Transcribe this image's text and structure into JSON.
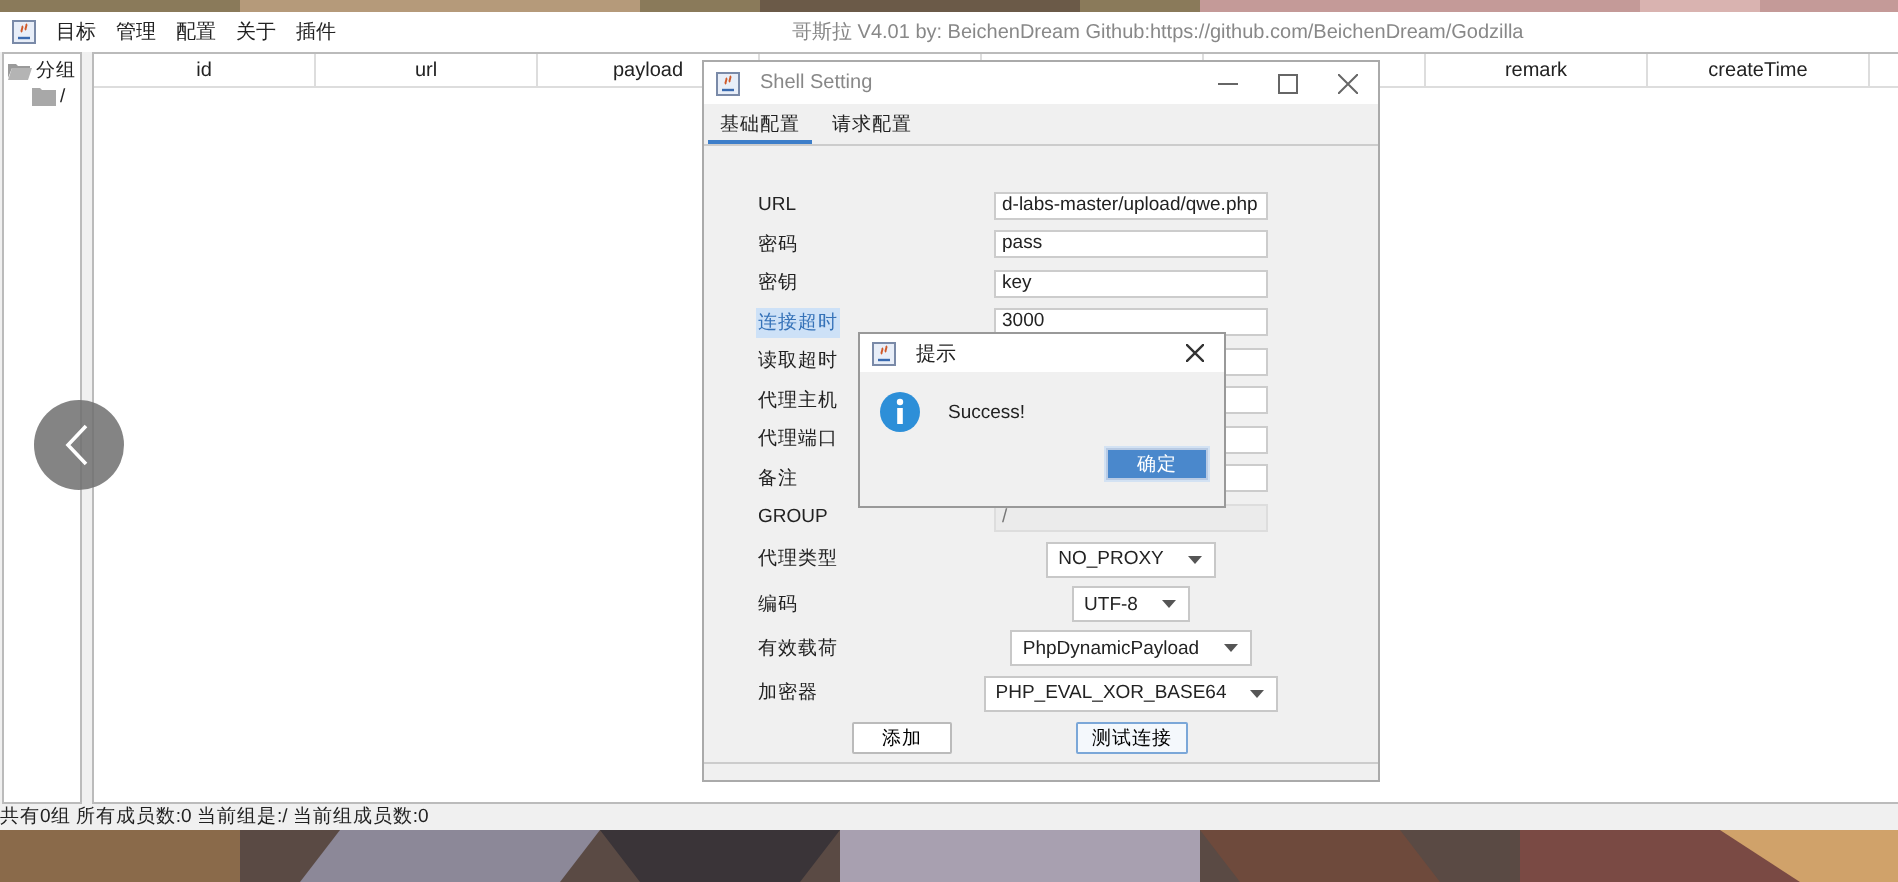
{
  "window": {
    "title": "哥斯拉    V4.01 by: BeichenDream Github:https://github.com/BeichenDream/Godzilla"
  },
  "menu": [
    "目标",
    "管理",
    "配置",
    "关于",
    "插件"
  ],
  "sidebar": {
    "tree": [
      {
        "label": "分组",
        "expanded": true,
        "children": [
          {
            "label": "/"
          }
        ]
      }
    ]
  },
  "table": {
    "columns": [
      "id",
      "url",
      "payload",
      "remark",
      "createTime"
    ]
  },
  "status_bar": "共有0组 所有成员数:0 当前组是:/ 当前组成员数:0",
  "dialog": {
    "title": "Shell Setting",
    "tabs": [
      {
        "label": "基础配置",
        "selected": true
      },
      {
        "label": "请求配置",
        "selected": false
      }
    ],
    "fields": [
      {
        "kind": "text",
        "label": "URL",
        "value": "d-labs-master/upload/qwe.php",
        "highlighted": false,
        "disabled": false
      },
      {
        "kind": "text",
        "label": "密码",
        "value": "pass",
        "highlighted": false,
        "disabled": false
      },
      {
        "kind": "text",
        "label": "密钥",
        "value": "key",
        "highlighted": false,
        "disabled": false
      },
      {
        "kind": "text",
        "label": "连接超时",
        "value": "3000",
        "highlighted": true,
        "disabled": false
      },
      {
        "kind": "text",
        "label": "读取超时",
        "highlighted": false,
        "disabled": false
      },
      {
        "kind": "text",
        "label": "代理主机",
        "highlighted": false,
        "disabled": false
      },
      {
        "kind": "text",
        "label": "代理端口",
        "highlighted": false,
        "disabled": false
      },
      {
        "kind": "text",
        "label": "备注",
        "highlighted": false,
        "disabled": false
      },
      {
        "kind": "text",
        "label": "GROUP",
        "value": "/",
        "highlighted": false,
        "disabled": true
      },
      {
        "kind": "select",
        "label": "代理类型",
        "value": "NO_PROXY",
        "highlighted": false,
        "disabled": false
      },
      {
        "kind": "select",
        "label": "编码",
        "value": "UTF-8",
        "highlighted": false,
        "disabled": false
      },
      {
        "kind": "select",
        "label": "有效载荷",
        "value": "PhpDynamicPayload",
        "highlighted": false,
        "disabled": false
      },
      {
        "kind": "select",
        "label": "加密器",
        "value": "PHP_EVAL_XOR_BASE64",
        "highlighted": false,
        "disabled": false
      }
    ],
    "buttons": [
      {
        "label": "添加",
        "focused": false
      },
      {
        "label": "测试连接",
        "focused": true
      }
    ]
  },
  "alert": {
    "title": "提示",
    "message": "Success!",
    "button": "确定"
  }
}
